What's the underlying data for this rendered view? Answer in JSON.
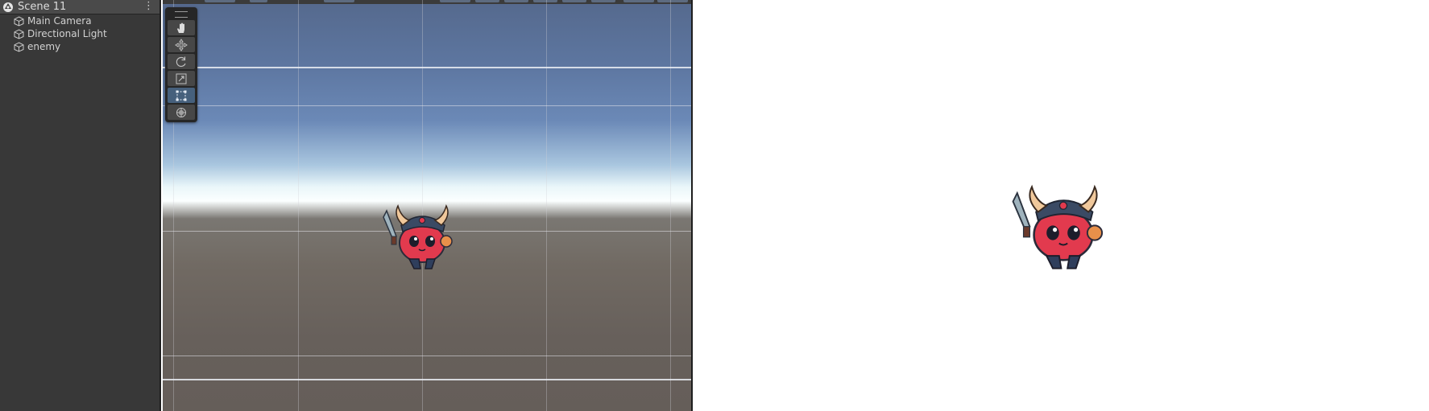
{
  "hierarchy": {
    "scene_name": "Scene 11",
    "menu_icon": "kebab-menu-icon",
    "items": [
      {
        "label": "Main Camera",
        "icon": "gameobject-cube-icon"
      },
      {
        "label": "Directional Light",
        "icon": "gameobject-cube-icon"
      },
      {
        "label": "enemy",
        "icon": "gameobject-cube-icon"
      }
    ]
  },
  "scene_view": {
    "tools": [
      {
        "name": "hand-tool",
        "icon": "hand-icon",
        "active": false
      },
      {
        "name": "move-tool",
        "icon": "move-arrows-icon",
        "active": false
      },
      {
        "name": "rotate-tool",
        "icon": "rotate-icon",
        "active": false
      },
      {
        "name": "scale-tool",
        "icon": "scale-icon",
        "active": false
      },
      {
        "name": "rect-tool",
        "icon": "rect-transform-icon",
        "active": true
      },
      {
        "name": "transform-tool",
        "icon": "transform-gizmo-icon",
        "active": false
      }
    ],
    "colors": {
      "sky_top": "#55698d",
      "horizon": "#fbffff",
      "ground": "#67605b",
      "active_tool": "#46607c"
    }
  },
  "game_view": {
    "background": "#ffffff",
    "sprite": "enemy-sprite"
  }
}
